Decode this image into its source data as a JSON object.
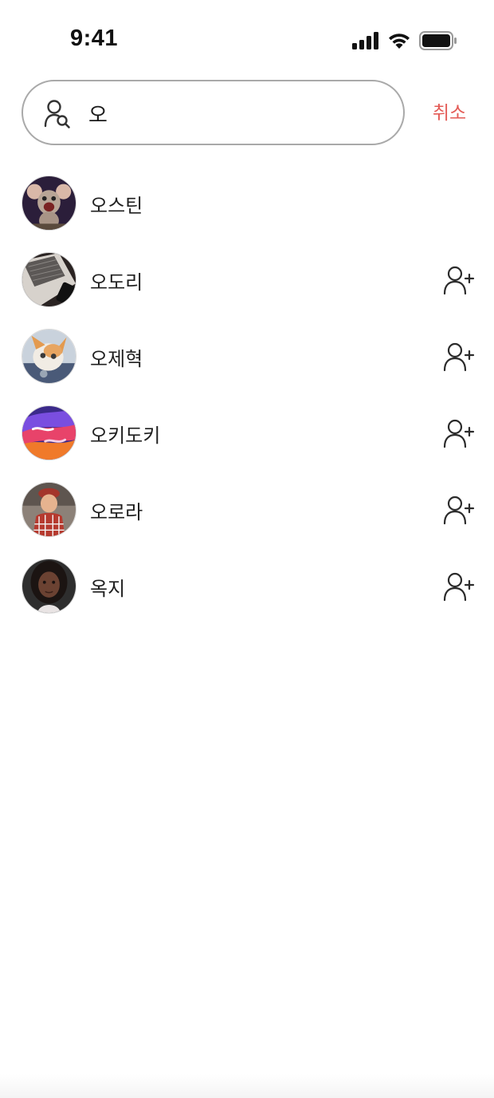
{
  "status_bar": {
    "time": "9:41",
    "icons": [
      "cellular-signal-icon",
      "wifi-icon",
      "battery-icon"
    ]
  },
  "search": {
    "value": "오",
    "icon": "person-search-icon",
    "cancel_label": "취소"
  },
  "results": [
    {
      "name": "오스틴",
      "avatar": "mouse-cartoon-avatar",
      "show_add_button": false
    },
    {
      "name": "오도리",
      "avatar": "laptop-desk-avatar",
      "show_add_button": true
    },
    {
      "name": "오제혁",
      "avatar": "kitten-avatar",
      "show_add_button": true
    },
    {
      "name": "오키도키",
      "avatar": "abstract-paint-avatar",
      "show_add_button": true
    },
    {
      "name": "오로라",
      "avatar": "child-cap-avatar",
      "show_add_button": true
    },
    {
      "name": "옥지",
      "avatar": "woman-portrait-avatar",
      "show_add_button": true
    }
  ],
  "colors": {
    "accent": "#e35a55",
    "text": "#1f1f1f",
    "border": "#a9a9a9"
  }
}
